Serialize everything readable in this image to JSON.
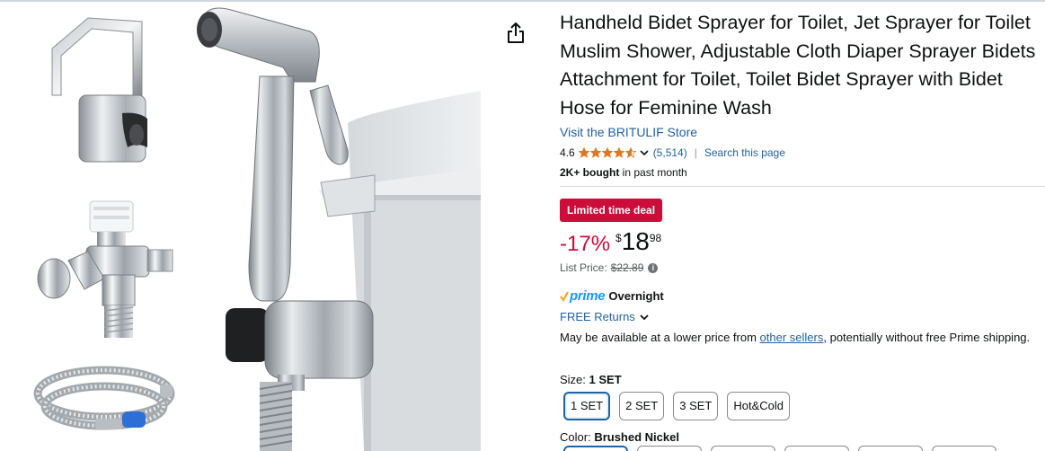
{
  "product": {
    "title": "Handheld Bidet Sprayer for Toilet, Jet Sprayer for Toilet Muslim Shower, Adjustable Cloth Diaper Sprayer Bidets Attachment for Toilet, Toilet Bidet Sprayer with Bidet Hose for Feminine Wash",
    "store_link": "Visit the BRITULIF Store",
    "rating_value": "4.6",
    "rating_stars": 4.6,
    "rating_count": "(5,514)",
    "rating_separator": "|",
    "search_link": "Search this page",
    "bought_bold": "2K+ bought",
    "bought_rest": "in past month"
  },
  "deal": {
    "badge": "Limited time deal",
    "discount": "-17%",
    "currency": "$",
    "price_whole": "18",
    "price_fraction": "98",
    "list_price_label": "List Price:",
    "list_price_value": "$22.89",
    "info_icon": "i"
  },
  "delivery": {
    "prime_word": "prime",
    "prime_speed": "Overnight",
    "returns": "FREE Returns",
    "lower_price_pre": "May be available at a lower price from ",
    "lower_price_link": "other sellers",
    "lower_price_post": ", potentially without free Prime shipping."
  },
  "size": {
    "label": "Size:",
    "selected": "1 SET",
    "options": [
      "1 SET",
      "2 SET",
      "3 SET",
      "Hot&Cold"
    ]
  },
  "color": {
    "label": "Color:",
    "selected": "Brushed Nickel"
  },
  "icons": {
    "share": "share-icon",
    "star": "star-icon",
    "chevron": "chevron-down-icon",
    "prime_check": "prime-check-icon",
    "info": "info-icon"
  },
  "colors": {
    "link": "#2162a1",
    "deal_red": "#cc0c39",
    "star_orange": "#de7921",
    "prime_blue": "#1399ff",
    "text": "#0f1111",
    "muted": "#565959"
  }
}
